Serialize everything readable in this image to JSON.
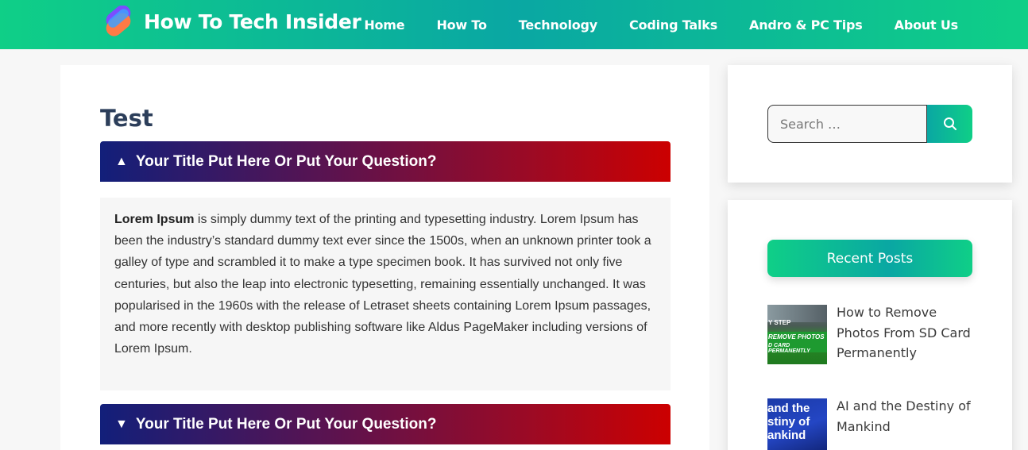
{
  "header": {
    "brand": "How To Tech Insider",
    "nav": [
      "Home",
      "How To",
      "Technology",
      "Coding Talks",
      "Andro & PC Tips",
      "About Us"
    ]
  },
  "main": {
    "title": "Test",
    "accordion": [
      {
        "arrow": "▲",
        "title": "Your Title Put Here Or Put Your Question?"
      },
      {
        "arrow": "▼",
        "title": "Your Title Put Here Or Put Your Question?"
      }
    ],
    "body_bold": "Lorem Ipsum",
    "body_text": " is simply dummy text of the printing and typesetting industry. Lorem Ipsum has been the industry’s standard dummy text ever since the 1500s, when an unknown printer took a galley of type and scrambled it to make a type specimen book. It has survived not only five centuries, but also the leap into electronic typesetting, remaining essentially unchanged. It was popularised in the 1960s with the release of Letraset sheets containing Lorem Ipsum passages, and more recently with desktop publishing software like Aldus PageMaker including versions of Lorem Ipsum."
  },
  "sidebar": {
    "search_placeholder": "Search …",
    "recent_title": "Recent Posts",
    "posts": [
      {
        "title": "How to Remove Photos From SD Card Permanently",
        "thumb_lines": [
          "Y STEP",
          "REMOVE PHOTOS",
          "D CARD PERMANENTLY"
        ]
      },
      {
        "title": "AI and the Destiny of Mankind",
        "thumb_lines": [
          "and the",
          "stiny of",
          "ankind"
        ]
      }
    ]
  },
  "colors": {
    "header_teal": "#0aa7a3",
    "header_green": "#0fcf87",
    "accordion_start": "#121f7a",
    "accordion_end": "#cc0000",
    "title_navy": "#2c3e5a"
  }
}
